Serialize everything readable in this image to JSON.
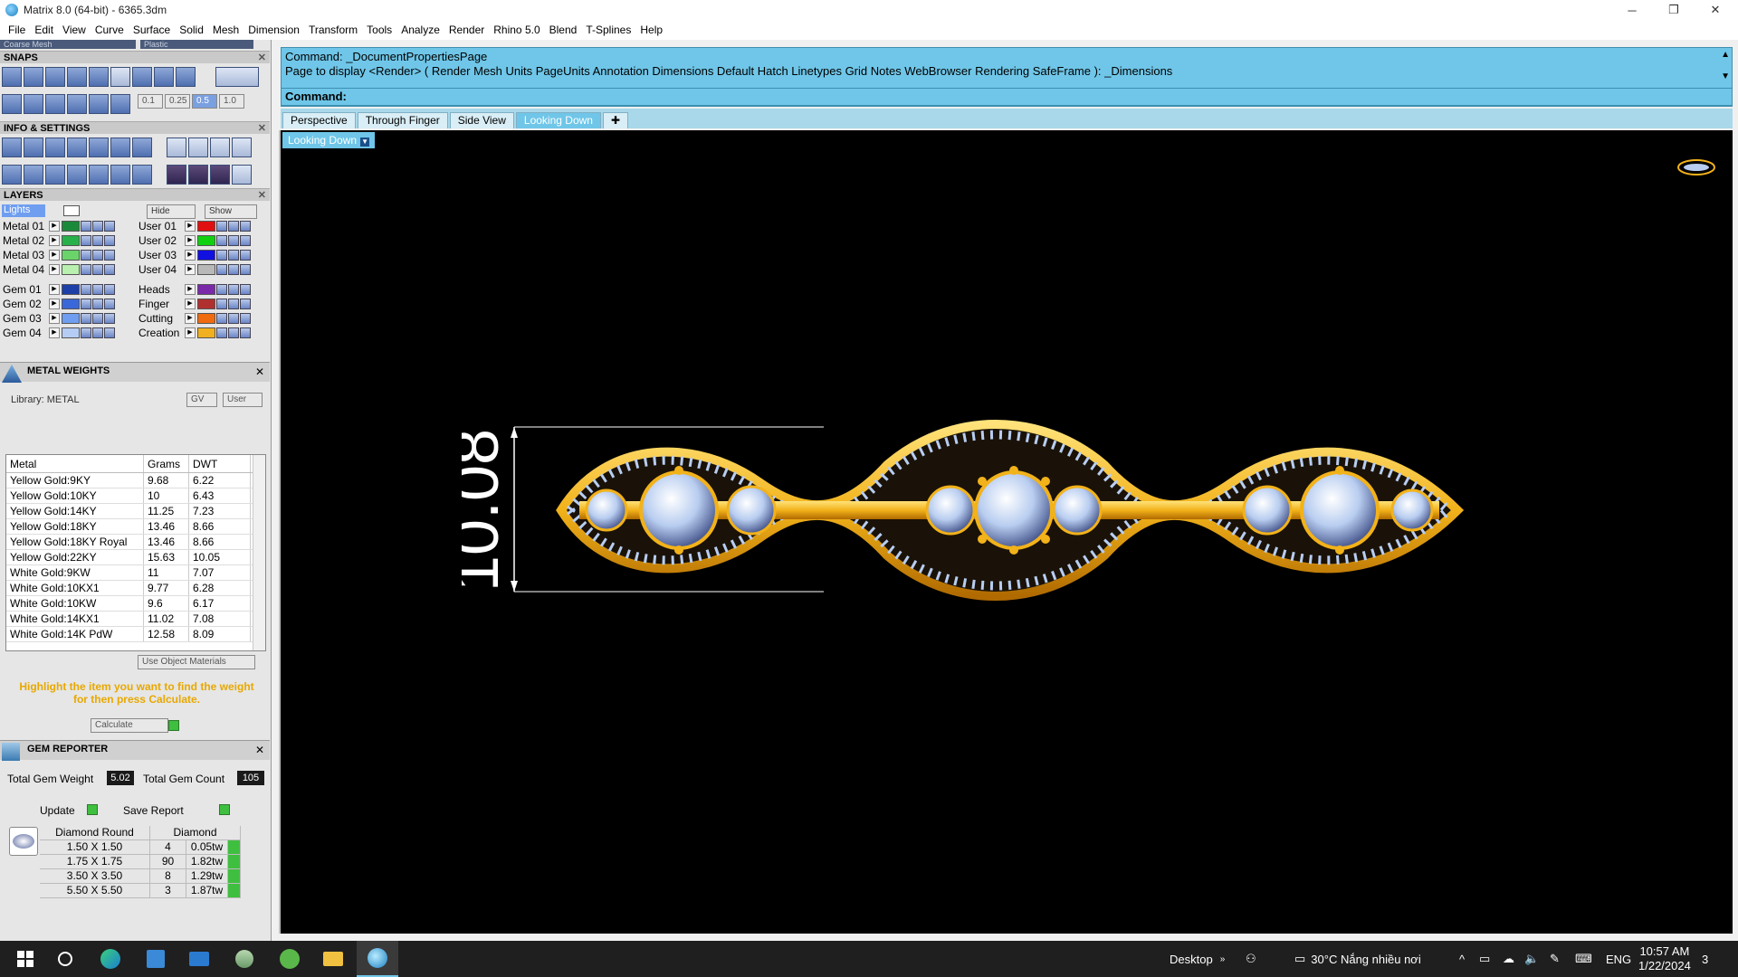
{
  "window": {
    "title": "Matrix 8.0 (64-bit) - 6365.3dm",
    "minimize_glyph": "─",
    "restore_glyph": "❐",
    "close_glyph": "✕"
  },
  "menu": [
    "File",
    "Edit",
    "View",
    "Curve",
    "Surface",
    "Solid",
    "Mesh",
    "Dimension",
    "Transform",
    "Tools",
    "Analyze",
    "Render",
    "Rhino 5.0",
    "Blend",
    "T-Splines",
    "Help"
  ],
  "left_panel": {
    "top_dropdowns": [
      "Coarse Mesh",
      "Plastic"
    ],
    "snaps": {
      "title": "SNAPS",
      "values": [
        "0.1",
        "0.25",
        "0.5",
        "1.0"
      ]
    },
    "info_settings": {
      "title": "INFO & SETTINGS"
    },
    "layers": {
      "title": "LAYERS",
      "lights_label": "Lights",
      "hide_label": "Hide",
      "show_label": "Show",
      "left_column": [
        {
          "name": "Metal 01",
          "color": "#1a8a3a"
        },
        {
          "name": "Metal 02",
          "color": "#28b04a"
        },
        {
          "name": "Metal 03",
          "color": "#6ad46a"
        },
        {
          "name": "Metal 04",
          "color": "#b9f0b0"
        },
        {
          "name": "Gem 01",
          "color": "#1c3fa8"
        },
        {
          "name": "Gem 02",
          "color": "#3a68d8"
        },
        {
          "name": "Gem 03",
          "color": "#6f9ef0"
        },
        {
          "name": "Gem 04",
          "color": "#b5cdf5"
        }
      ],
      "right_column": [
        {
          "name": "User 01",
          "color": "#e01010"
        },
        {
          "name": "User 02",
          "color": "#10d010"
        },
        {
          "name": "User 03",
          "color": "#1010e0"
        },
        {
          "name": "User 04",
          "color": "#b8b8b8"
        },
        {
          "name": "Heads",
          "color": "#7a2aa8"
        },
        {
          "name": "Finger",
          "color": "#b03030"
        },
        {
          "name": "Cutting",
          "color": "#f06a10"
        },
        {
          "name": "Creation",
          "color": "#f0b020"
        }
      ]
    },
    "metal_weights": {
      "title": "METAL WEIGHTS",
      "library": "Library: METAL",
      "gv_label": "GV",
      "user_label": "User",
      "columns": [
        "Metal",
        "Grams",
        "DWT"
      ],
      "rows": [
        [
          "Yellow Gold:9KY",
          "9.68",
          "6.22"
        ],
        [
          "Yellow Gold:10KY",
          "10",
          "6.43"
        ],
        [
          "Yellow Gold:14KY",
          "11.25",
          "7.23"
        ],
        [
          "Yellow Gold:18KY",
          "13.46",
          "8.66"
        ],
        [
          "Yellow Gold:18KY Royal",
          "13.46",
          "8.66"
        ],
        [
          "Yellow Gold:22KY",
          "15.63",
          "10.05"
        ],
        [
          "White Gold:9KW",
          "11",
          "7.07"
        ],
        [
          "White Gold:10KX1",
          "9.77",
          "6.28"
        ],
        [
          "White Gold:10KW",
          "9.6",
          "6.17"
        ],
        [
          "White Gold:14KX1",
          "11.02",
          "7.08"
        ],
        [
          "White Gold:14K PdW",
          "12.58",
          "8.09"
        ]
      ],
      "use_object_materials": "Use Object Materials",
      "hint": "Highlight the item you want to find the weight for then press Calculate.",
      "calculate": "Calculate"
    },
    "gem_reporter": {
      "title": "GEM REPORTER",
      "total_weight_label": "Total Gem Weight",
      "total_weight": "5.02",
      "total_count_label": "Total Gem Count",
      "total_count": "105",
      "update": "Update",
      "save_report": "Save Report",
      "columns": [
        "Diamond Round",
        "Diamond"
      ],
      "rows": [
        [
          "1.50 X 1.50",
          "4",
          "0.05tw"
        ],
        [
          "1.75 X 1.75",
          "90",
          "1.82tw"
        ],
        [
          "3.50 X 3.50",
          "8",
          "1.29tw"
        ],
        [
          "5.50 X 5.50",
          "3",
          "1.87tw"
        ]
      ]
    }
  },
  "command": {
    "line1": "Command: _DocumentPropertiesPage",
    "line2": "Page to display <Render> ( Render  Mesh  Units  PageUnits  Annotation  Dimensions  Default  Hatch  Linetypes  Grid  Notes  WebBrowser  Rendering  SafeFrame ): _Dimensions",
    "prompt": "Command:"
  },
  "tabs": [
    "Perspective",
    "Through Finger",
    "Side View",
    "Looking Down"
  ],
  "active_tab": "Looking Down",
  "viewport": {
    "label": "Looking Down",
    "dimension": "10.08",
    "colors": {
      "gold": "#f2b21a",
      "gem": "#b8cdf0",
      "background": "#000000"
    }
  },
  "taskbar": {
    "desktop": "Desktop",
    "weather": "30°C  Nắng nhiều nơi",
    "lang": "ENG",
    "time": "10:57 AM",
    "date": "1/22/2024",
    "notifications": "3"
  }
}
